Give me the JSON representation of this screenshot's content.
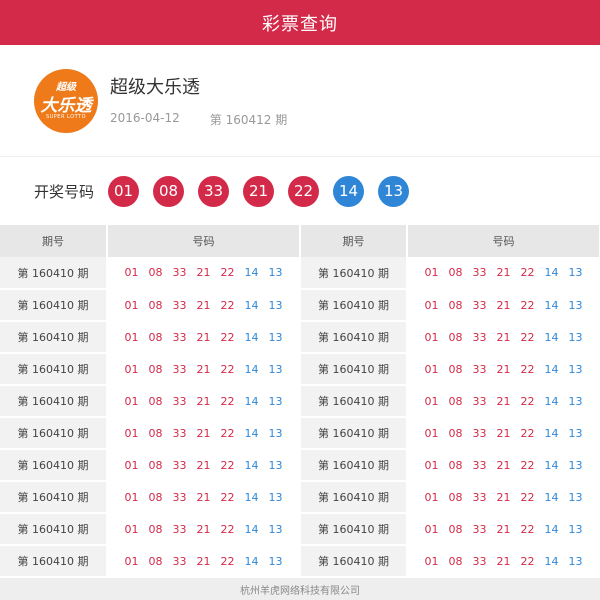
{
  "header": {
    "title": "彩票查询"
  },
  "lottery": {
    "logo_text_top": "超级",
    "logo_text_main": "大乐透",
    "logo_text_small": "SUPER LOTTO",
    "name": "超级大乐透",
    "date": "2016-04-12",
    "issue": "第 160412 期"
  },
  "draw": {
    "label": "开奖号码",
    "balls": [
      {
        "num": "01",
        "color": "red"
      },
      {
        "num": "08",
        "color": "red"
      },
      {
        "num": "33",
        "color": "red"
      },
      {
        "num": "21",
        "color": "red"
      },
      {
        "num": "22",
        "color": "red"
      },
      {
        "num": "14",
        "color": "blue"
      },
      {
        "num": "13",
        "color": "blue"
      }
    ]
  },
  "table": {
    "headers": [
      "期号",
      "号码",
      "期号",
      "号码"
    ],
    "rows": [
      {
        "left": {
          "issue": "第 160410 期",
          "red": [
            "01",
            "08",
            "33",
            "21",
            "22"
          ],
          "blue": [
            "14",
            "13"
          ]
        },
        "right": {
          "issue": "第 160410 期",
          "red": [
            "01",
            "08",
            "33",
            "21",
            "22"
          ],
          "blue": [
            "14",
            "13"
          ]
        }
      },
      {
        "left": {
          "issue": "第 160410 期",
          "red": [
            "01",
            "08",
            "33",
            "21",
            "22"
          ],
          "blue": [
            "14",
            "13"
          ]
        },
        "right": {
          "issue": "第 160410 期",
          "red": [
            "01",
            "08",
            "33",
            "21",
            "22"
          ],
          "blue": [
            "14",
            "13"
          ]
        }
      },
      {
        "left": {
          "issue": "第 160410 期",
          "red": [
            "01",
            "08",
            "33",
            "21",
            "22"
          ],
          "blue": [
            "14",
            "13"
          ]
        },
        "right": {
          "issue": "第 160410 期",
          "red": [
            "01",
            "08",
            "33",
            "21",
            "22"
          ],
          "blue": [
            "14",
            "13"
          ]
        }
      },
      {
        "left": {
          "issue": "第 160410 期",
          "red": [
            "01",
            "08",
            "33",
            "21",
            "22"
          ],
          "blue": [
            "14",
            "13"
          ]
        },
        "right": {
          "issue": "第 160410 期",
          "red": [
            "01",
            "08",
            "33",
            "21",
            "22"
          ],
          "blue": [
            "14",
            "13"
          ]
        }
      },
      {
        "left": {
          "issue": "第 160410 期",
          "red": [
            "01",
            "08",
            "33",
            "21",
            "22"
          ],
          "blue": [
            "14",
            "13"
          ]
        },
        "right": {
          "issue": "第 160410 期",
          "red": [
            "01",
            "08",
            "33",
            "21",
            "22"
          ],
          "blue": [
            "14",
            "13"
          ]
        }
      },
      {
        "left": {
          "issue": "第 160410 期",
          "red": [
            "01",
            "08",
            "33",
            "21",
            "22"
          ],
          "blue": [
            "14",
            "13"
          ]
        },
        "right": {
          "issue": "第 160410 期",
          "red": [
            "01",
            "08",
            "33",
            "21",
            "22"
          ],
          "blue": [
            "14",
            "13"
          ]
        }
      },
      {
        "left": {
          "issue": "第 160410 期",
          "red": [
            "01",
            "08",
            "33",
            "21",
            "22"
          ],
          "blue": [
            "14",
            "13"
          ]
        },
        "right": {
          "issue": "第 160410 期",
          "red": [
            "01",
            "08",
            "33",
            "21",
            "22"
          ],
          "blue": [
            "14",
            "13"
          ]
        }
      },
      {
        "left": {
          "issue": "第 160410 期",
          "red": [
            "01",
            "08",
            "33",
            "21",
            "22"
          ],
          "blue": [
            "14",
            "13"
          ]
        },
        "right": {
          "issue": "第 160410 期",
          "red": [
            "01",
            "08",
            "33",
            "21",
            "22"
          ],
          "blue": [
            "14",
            "13"
          ]
        }
      },
      {
        "left": {
          "issue": "第 160410 期",
          "red": [
            "01",
            "08",
            "33",
            "21",
            "22"
          ],
          "blue": [
            "14",
            "13"
          ]
        },
        "right": {
          "issue": "第 160410 期",
          "red": [
            "01",
            "08",
            "33",
            "21",
            "22"
          ],
          "blue": [
            "14",
            "13"
          ]
        }
      },
      {
        "left": {
          "issue": "第 160410 期",
          "red": [
            "01",
            "08",
            "33",
            "21",
            "22"
          ],
          "blue": [
            "14",
            "13"
          ]
        },
        "right": {
          "issue": "第 160410 期",
          "red": [
            "01",
            "08",
            "33",
            "21",
            "22"
          ],
          "blue": [
            "14",
            "13"
          ]
        }
      }
    ]
  },
  "footer": {
    "text": "杭州羊虎网络科技有限公司"
  },
  "colors": {
    "accent": "#d42a4a",
    "red_ball": "#d42a4a",
    "blue_ball": "#2f86d6",
    "logo": "#ee7a1a"
  }
}
